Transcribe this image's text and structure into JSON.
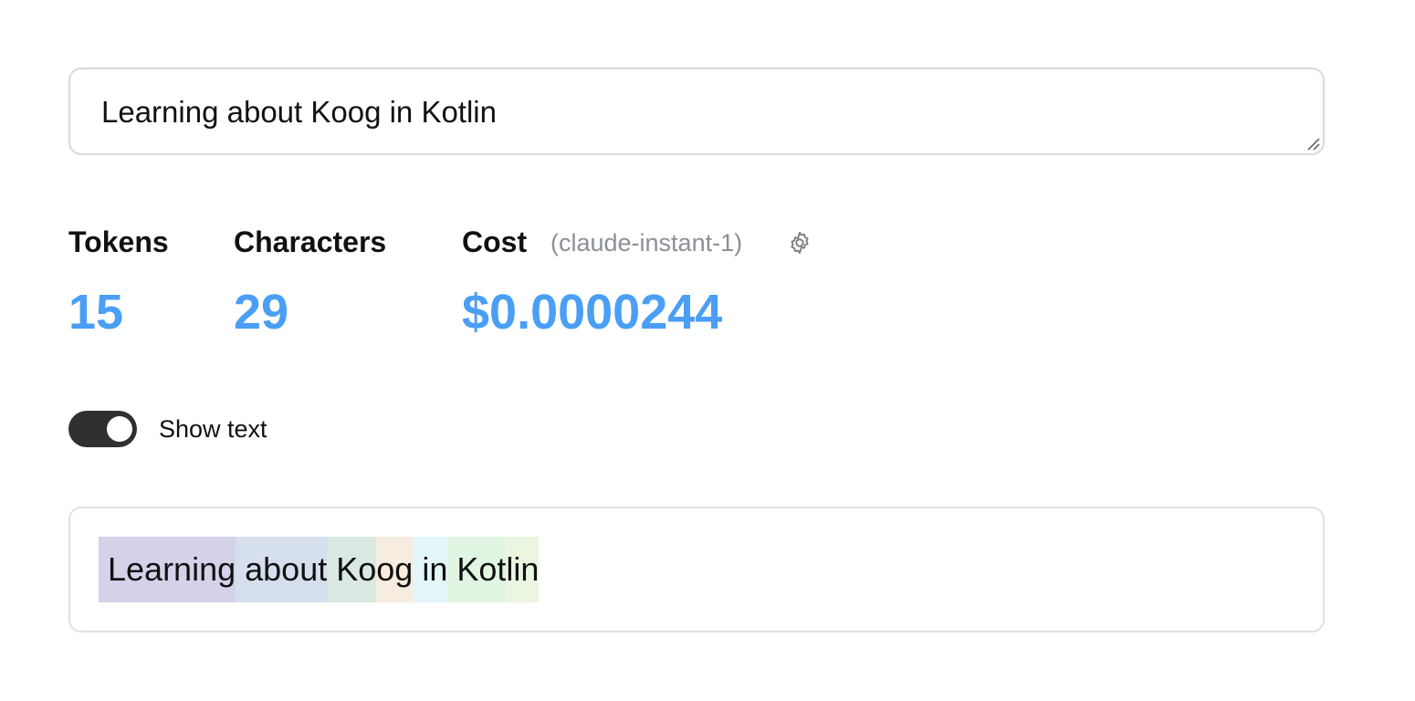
{
  "input": {
    "text": "Learning about Koog in Kotlin"
  },
  "stats": {
    "tokens": {
      "label": "Tokens",
      "value": "15"
    },
    "characters": {
      "label": "Characters",
      "value": "29"
    },
    "cost": {
      "label": "Cost",
      "model": "(claude-instant-1)",
      "value": "$0.0000244"
    },
    "settings_icon": "gear-icon"
  },
  "toggle": {
    "label": "Show text",
    "on": true
  },
  "tokens": [
    {
      "text": " Learning",
      "color": "#d4d2e9"
    },
    {
      "text": " about",
      "color": "#d6dfee"
    },
    {
      "text": " Ko",
      "color": "#d9e8e0"
    },
    {
      "text": "og",
      "color": "#f6ece0"
    },
    {
      "text": " in",
      "color": "#e3f6f8"
    },
    {
      "text": " Kot",
      "color": "#e1f5e3"
    },
    {
      "text": "lin",
      "color": "#ebf6e0"
    }
  ],
  "colors": {
    "accent": "#4a9ff5",
    "toggle_track": "#303030",
    "muted_text": "#8a8f98",
    "border": "#d9d9d9"
  }
}
